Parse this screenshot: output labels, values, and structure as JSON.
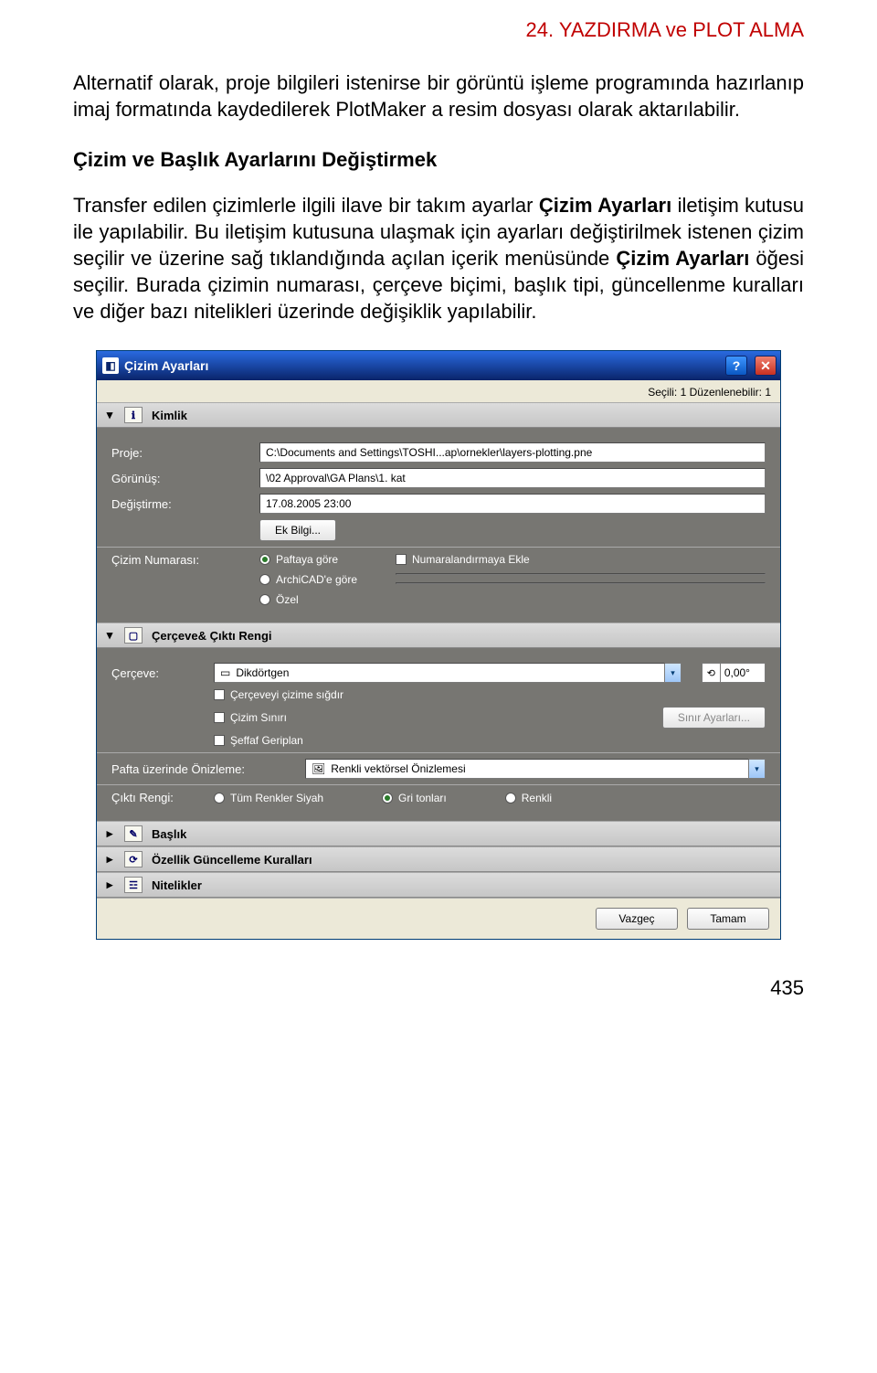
{
  "doc": {
    "header": "24. YAZDIRMA ve PLOT ALMA",
    "para1": "Alternatif olarak, proje bilgileri istenirse bir görüntü işleme programında hazırlanıp imaj formatında kaydedilerek PlotMaker a resim dosyası olarak aktarılabilir.",
    "subhead": "Çizim ve Başlık Ayarlarını Değiştirmek",
    "para2a": "Transfer edilen çizimlerle ilgili ilave bir takım ayarlar ",
    "para2b": "Çizim Ayarları",
    "para2c": " iletişim kutusu ile yapılabilir. Bu iletişim kutusuna ulaşmak için ayarları değiştirilmek istenen çizim seçilir ve üzerine sağ tıklandığında açılan içerik menüsünde ",
    "para2d": "Çizim Ayarları",
    "para2e": " öğesi seçilir. Burada çizimin numarası, çerçeve biçimi, başlık tipi, güncellenme kuralları ve diğer bazı nitelikleri üzerinde değişiklik yapılabilir.",
    "pagenum": "435"
  },
  "dlg": {
    "title": "Çizim Ayarları",
    "status": "Seçili: 1 Düzenlenebilir: 1",
    "sec_kimlik": "Kimlik",
    "proje_lbl": "Proje:",
    "proje_val": "C:\\Documents and Settings\\TOSHI...ap\\ornekler\\layers-plotting.pne",
    "gorunus_lbl": "Görünüş:",
    "gorunus_val": "\\02 Approval\\GA Plans\\1. kat",
    "degistirme_lbl": "Değiştirme:",
    "degistirme_val": "17.08.2005 23:00",
    "ekbilgi": "Ek Bilgi...",
    "cizimno_lbl": "Çizim Numarası:",
    "r_pafta": "Paftaya göre",
    "r_archi": "ArchiCAD'e göre",
    "r_ozel": "Özel",
    "c_numara": "Numaralandırmaya Ekle",
    "sec_cerceve": "Çerçeve& Çıktı Rengi",
    "cerceve_lbl": "Çerçeve:",
    "cerceve_val": "Dikdörtgen",
    "rot_val": "0,00°",
    "c_sigdir": "Çerçeveyi çizime sığdır",
    "c_sinir": "Çizim Sınırı",
    "sinir_btn": "Sınır Ayarları...",
    "c_seffaf": "Şeffaf Geriplan",
    "onizleme_lbl": "Pafta üzerinde Önizleme:",
    "onizleme_val": "Renkli vektörsel Önizlemesi",
    "cikti_lbl": "Çıktı Rengi:",
    "r_siyah": "Tüm Renkler Siyah",
    "r_gri": "Gri tonları",
    "r_renkli": "Renkli",
    "sec_baslik": "Başlık",
    "sec_ozellik": "Özellik Güncelleme Kuralları",
    "sec_nitelik": "Nitelikler",
    "vazgec": "Vazgeç",
    "tamam": "Tamam"
  }
}
